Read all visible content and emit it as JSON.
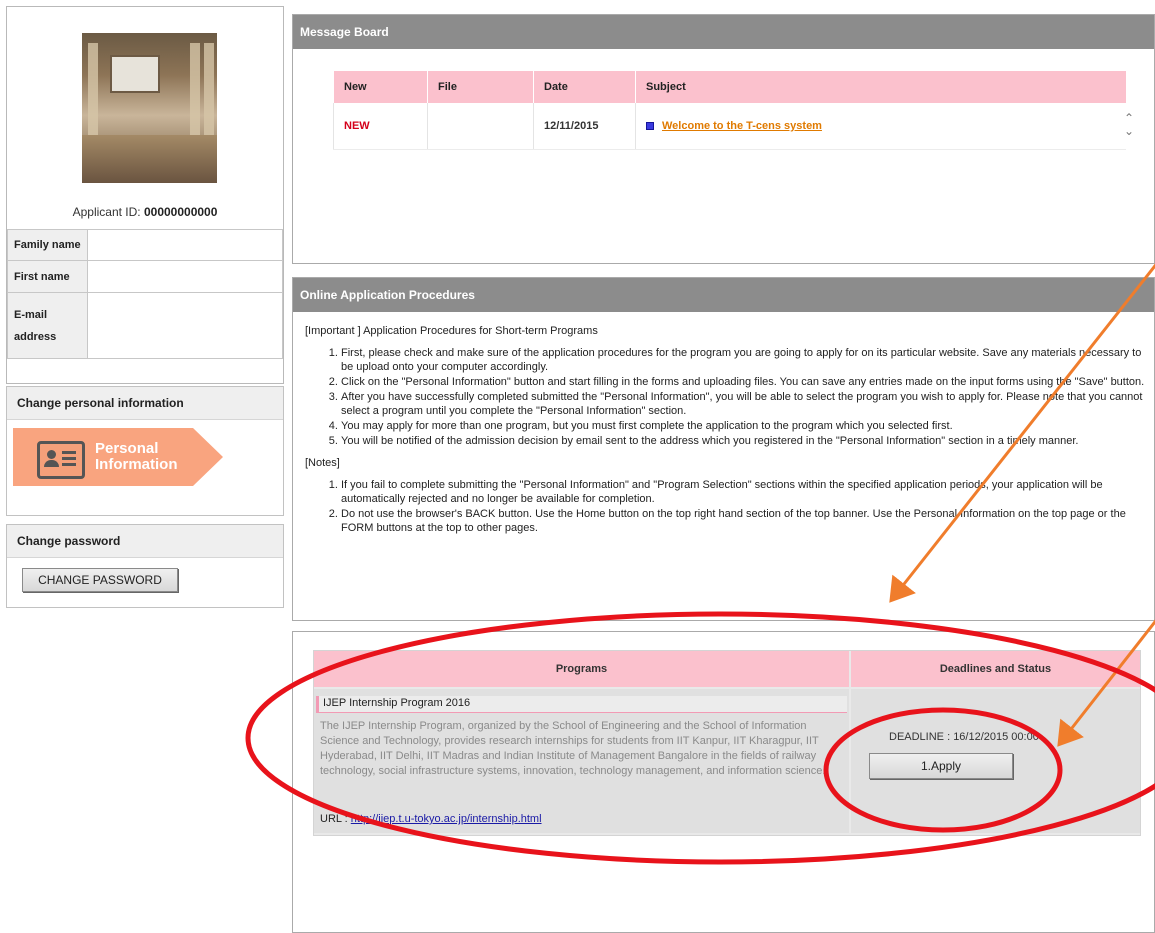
{
  "profile": {
    "applicant_id_label": "Applicant ID:",
    "applicant_id_value": "00000000000",
    "family_name_label": "Family name",
    "family_name_value": "",
    "first_name_label": "First name",
    "first_name_value": "",
    "email_label_line1": "E-mail",
    "email_label_line2": "address",
    "email_value": ""
  },
  "personal_info": {
    "heading": "Change personal information",
    "banner_line1": "Personal",
    "banner_line2": "Information",
    "icon": "id-card-icon"
  },
  "password": {
    "heading": "Change password",
    "button_label": "CHANGE PASSWORD"
  },
  "message_board": {
    "title": "Message Board",
    "columns": [
      "New",
      "File",
      "Date",
      "Subject"
    ],
    "rows": [
      {
        "new": "NEW",
        "file": "",
        "date": "12/11/2015",
        "subject": "Welcome to the T-cens system"
      }
    ]
  },
  "procedures": {
    "title": "Online Application Procedures",
    "important": "[Important ] Application Procedures for Short-term Programs",
    "steps": [
      "First, please check and make sure of the application procedures for the program you are going to apply for on its particular website. Save any materials necessary to be upload onto your computer accordingly.",
      "Click on the \"Personal Information\" button and start filling in the forms and uploading files. You can save any entries made on the input forms using the \"Save\" button.",
      "After you have successfully completed submitted the \"Personal Information\", you will be able to select the program you wish to apply for. Please note that you cannot select a program until you complete the \"Personal Information\" section.",
      "You may apply for more than one program, but you must first complete the application to the program which you selected first.",
      "You will be notified of the admission decision by email sent to the address which you registered in the \"Personal Information\" section in a timely manner."
    ],
    "notes_heading": "[Notes]",
    "notes": [
      "If you fail to complete submitting the \"Personal Information\" and \"Program Selection\" sections within the specified application periods, your application will be automatically rejected and no longer be available for completion.",
      "Do not use the browser's BACK button. Use the Home button on the top right hand section of the top banner. Use the Personal Information on the top page or the FORM buttons at the top to other pages."
    ]
  },
  "programs": {
    "col_programs": "Programs",
    "col_deadlines": "Deadlines and Status",
    "program_name": "IJEP Internship Program 2016",
    "description": "The IJEP Internship Program, organized by the School of Engineering and the School of Information Science and Technology, provides research internships for students from IIT Kanpur, IIT Kharagpur, IIT Hyderabad, IIT Delhi, IIT Madras and Indian Institute of Management Bangalore in the fields of railway technology, social infrastructure systems, innovation, technology management, and information science.",
    "url_label": "URL : ",
    "url": "http://iiep.t.u-tokyo.ac.jp/internship.html",
    "deadline_label": "DEADLINE : ",
    "deadline_value": "16/12/2015 00:00",
    "apply_label": "1.Apply"
  },
  "colors": {
    "header_gray": "#8c8c8c",
    "table_pink": "#fbc1cd",
    "banner_orange": "#f9a47f",
    "annotation_red": "#e8131b",
    "annotation_arrow": "#f07d2c"
  }
}
